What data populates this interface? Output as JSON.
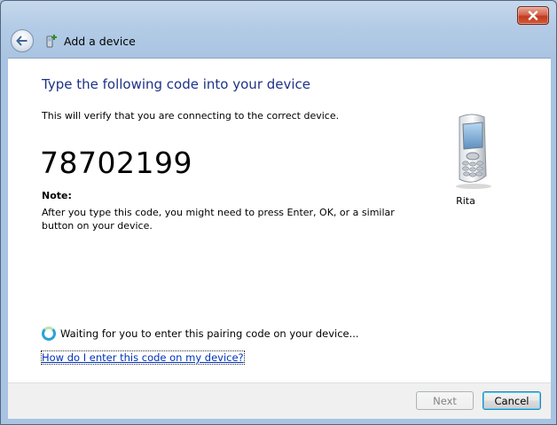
{
  "window": {
    "title": "Add a device",
    "close_icon": "close-icon",
    "back_icon": "back-arrow-icon"
  },
  "main": {
    "heading": "Type the following code into your device",
    "description": "This will verify that you are connecting to the correct device.",
    "code": "78702199",
    "note_title": "Note:",
    "note_text": "After you type this code, you might need to press Enter, OK, or a similar button on your device.",
    "device_name": "Rita",
    "status_text": "Waiting for you to enter this pairing code on your device...",
    "help_link": "How do I enter this code on my device?"
  },
  "footer": {
    "next_label": "Next",
    "cancel_label": "Cancel"
  },
  "colors": {
    "heading": "#1e3287",
    "link": "#0033bb",
    "close_button": "#c03b1f"
  }
}
